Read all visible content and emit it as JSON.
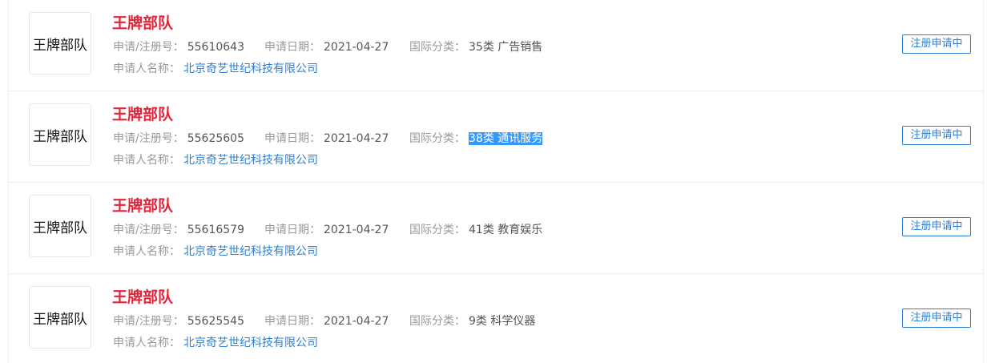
{
  "labels": {
    "reg_no": "申请/注册号：",
    "apply_date": "申请日期：",
    "intl_class": "国际分类：",
    "applicant": "申请人名称："
  },
  "items": [
    {
      "logo_text": "王牌部队",
      "name": "王牌部队",
      "reg_no": "55610643",
      "apply_date": "2021-04-27",
      "intl_class": "35类 广告销售",
      "applicant": "北京奇艺世纪科技有限公司",
      "status": "注册申请中"
    },
    {
      "logo_text": "王牌部队",
      "name": "王牌部队",
      "reg_no": "55625605",
      "apply_date": "2021-04-27",
      "intl_class": "38类 通讯服务",
      "applicant": "北京奇艺世纪科技有限公司",
      "status": "注册申请中"
    },
    {
      "logo_text": "王牌部队",
      "name": "王牌部队",
      "reg_no": "55616579",
      "apply_date": "2021-04-27",
      "intl_class": "41类 教育娱乐",
      "applicant": "北京奇艺世纪科技有限公司",
      "status": "注册申请中"
    },
    {
      "logo_text": "王牌部队",
      "name": "王牌部队",
      "reg_no": "55625545",
      "apply_date": "2021-04-27",
      "intl_class": "9类 科学仪器",
      "applicant": "北京奇艺世纪科技有限公司",
      "status": "注册申请中"
    }
  ],
  "colors": {
    "name": "#e0243a",
    "link": "#2f7fd1",
    "selection": "#3399ff"
  }
}
